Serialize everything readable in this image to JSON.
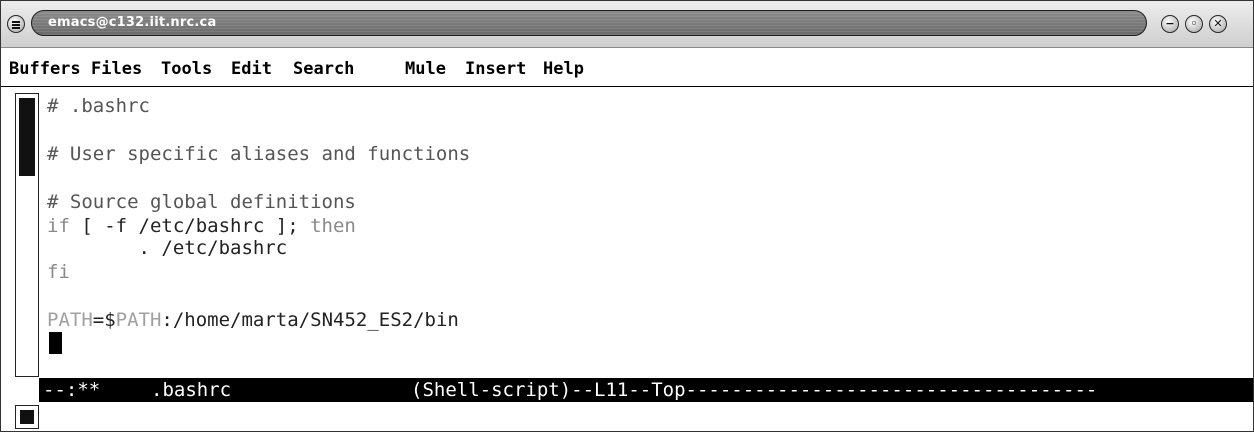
{
  "window": {
    "title": "emacs@c132.iit.nrc.ca"
  },
  "menubar": {
    "items": [
      "Buffers",
      "Files",
      "Tools",
      "Edit",
      "Search",
      "Mule",
      "Insert",
      "Help"
    ]
  },
  "buffer": {
    "lines": [
      "# .bashrc",
      "",
      "# User specific aliases and functions",
      "",
      "# Source global definitions",
      "if [ -f /etc/bashrc ]; then",
      "        . /etc/bashrc",
      "fi",
      "",
      "PATH=$PATH:/home/marta/SN452_ES2/bin"
    ],
    "line5_parts": {
      "kw1": "if",
      "mid": " [ -f /etc/bashrc ]; ",
      "kw2": "then"
    },
    "line10_parts": {
      "var1": "PATH",
      "eq": "=$",
      "var2": "PATH",
      "rest": ":/home/marta/SN452_ES2/bin"
    }
  },
  "modeline": {
    "status": "--:**",
    "buffer_name": ".bashrc",
    "mode_info": "(Shell-script)--L11--Top------------------------------------"
  },
  "colors": {
    "modeline_bg": "#000000",
    "modeline_fg": "#ffffff"
  }
}
